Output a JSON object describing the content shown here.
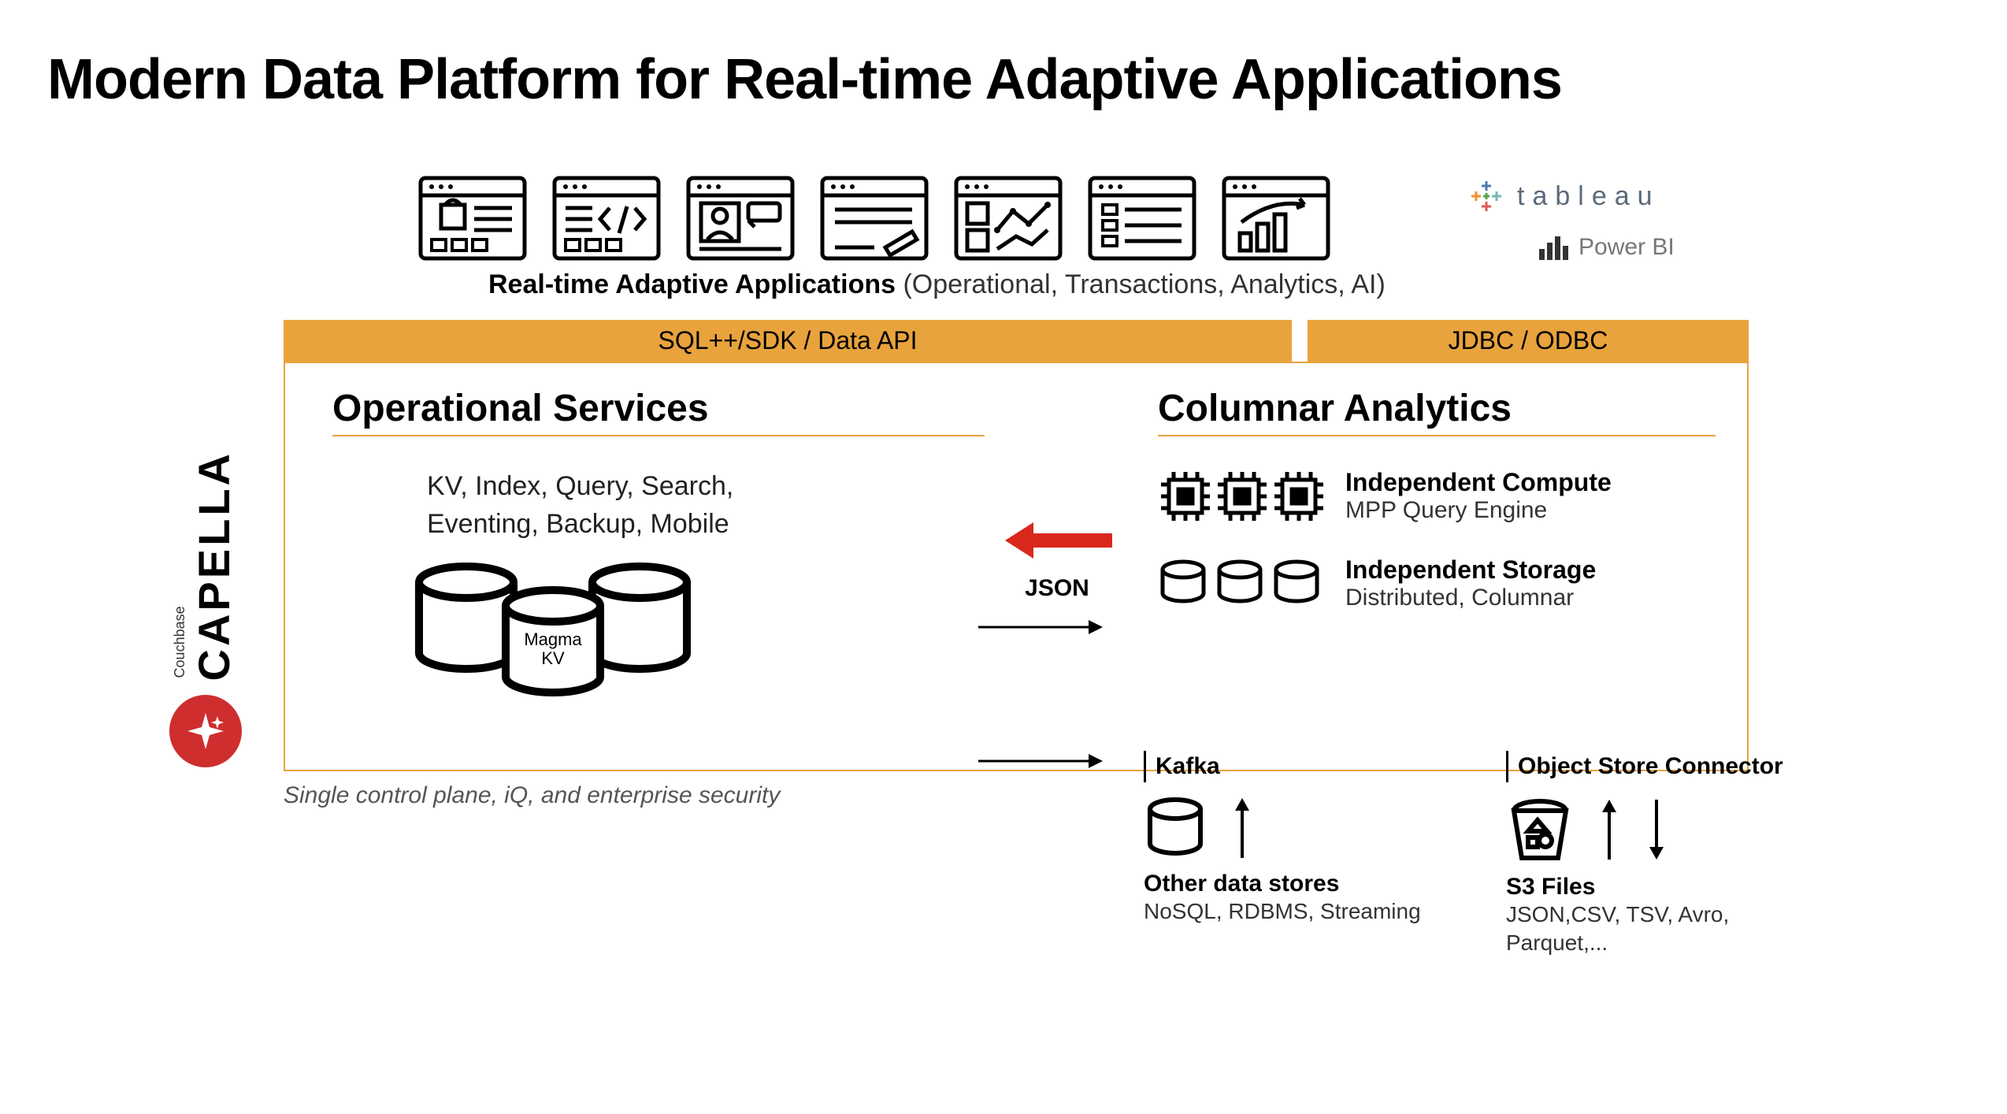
{
  "title": "Modern Data Platform for Real-time Adaptive Applications",
  "apps_caption_bold": "Real-time Adaptive Applications",
  "apps_caption_rest": " (Operational, Transactions, Analytics, AI)",
  "bi": {
    "tableau": "tableau",
    "powerbi": "Power BI"
  },
  "bars": {
    "left": "SQL++/SDK / Data API",
    "right": "JDBC / ODBC"
  },
  "capella": {
    "brand": "Couchbase",
    "product": "CAPELLA"
  },
  "operational": {
    "heading": "Operational Services",
    "services_line1": "KV, Index, Query, Search,",
    "services_line2": "Eventing, Backup, Mobile",
    "magma": "Magma",
    "kv": "KV"
  },
  "json_label": "JSON",
  "analytics": {
    "heading": "Columnar Analytics",
    "compute_title": "Independent Compute",
    "compute_sub": "MPP Query Engine",
    "storage_title": "Independent Storage",
    "storage_sub": "Distributed, Columnar"
  },
  "footer_note": "Single control plane, iQ, and enterprise security",
  "connectors": {
    "kafka_header": "Kafka",
    "kafka_title": "Other data stores",
    "kafka_sub": "NoSQL, RDBMS, Streaming",
    "obj_header": "Object Store Connector",
    "obj_title": "S3 Files",
    "obj_sub": "JSON,CSV, TSV, Avro, Parquet,..."
  }
}
